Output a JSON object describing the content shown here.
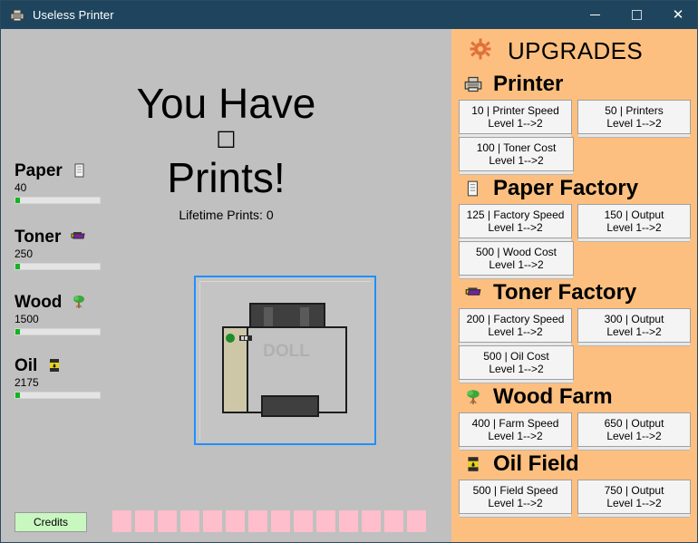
{
  "window": {
    "title": "Useless Printer",
    "icon": "printer-icon",
    "titlebar_color": "#1f455e",
    "controls": {
      "minimize": "—",
      "maximize": "□",
      "close": "✕"
    }
  },
  "resources": [
    {
      "name": "Paper",
      "value": "40",
      "icon": "paper-icon",
      "fill_percent": 5
    },
    {
      "name": "Toner",
      "value": "250",
      "icon": "toner-icon",
      "fill_percent": 5
    },
    {
      "name": "Wood",
      "value": "1500",
      "icon": "wood-icon",
      "fill_percent": 5
    },
    {
      "name": "Oil",
      "value": "2175",
      "icon": "oil-icon",
      "fill_percent": 5
    }
  ],
  "headline": {
    "line1": "You Have",
    "count": "☐",
    "line2": "Prints!",
    "lifetime": "Lifetime Prints: 0"
  },
  "printer": {
    "brand": "DOLL",
    "focus_color": "#1e90ff",
    "led_color": "#1e8c2a"
  },
  "footer": {
    "credits_label": "Credits",
    "credits_color": "#c9f7c0",
    "square_color": "#ffbecb",
    "square_count": 14
  },
  "upgrades": {
    "panel_color": "#fcbf7f",
    "header": {
      "title": "UPGRADES",
      "icon": "gear-icon"
    },
    "sections": [
      {
        "title": "Printer",
        "icon": "printer-icon",
        "buttons": [
          {
            "cost_label": "10 | Printer Speed",
            "level_label": "Level 1-->2"
          },
          {
            "cost_label": "50 | Printers",
            "level_label": "Level 1-->2"
          },
          {
            "cost_label": "100 | Toner Cost",
            "level_label": "Level 1-->2"
          }
        ]
      },
      {
        "title": "Paper Factory",
        "icon": "paper-icon",
        "buttons": [
          {
            "cost_label": "125 | Factory Speed",
            "level_label": "Level 1-->2"
          },
          {
            "cost_label": "150 | Output",
            "level_label": "Level 1-->2"
          },
          {
            "cost_label": "500 | Wood Cost",
            "level_label": "Level 1-->2"
          }
        ]
      },
      {
        "title": "Toner Factory",
        "icon": "toner-icon",
        "buttons": [
          {
            "cost_label": "200 | Factory Speed",
            "level_label": "Level 1-->2"
          },
          {
            "cost_label": "300 | Output",
            "level_label": "Level 1-->2"
          },
          {
            "cost_label": "500 | Oil Cost",
            "level_label": "Level 1-->2"
          }
        ]
      },
      {
        "title": "Wood Farm",
        "icon": "wood-icon",
        "buttons": [
          {
            "cost_label": "400 | Farm Speed",
            "level_label": "Level 1-->2"
          },
          {
            "cost_label": "650 | Output",
            "level_label": "Level 1-->2"
          }
        ]
      },
      {
        "title": "Oil Field",
        "icon": "oil-icon",
        "buttons": [
          {
            "cost_label": "500 | Field Speed",
            "level_label": "Level 1-->2"
          },
          {
            "cost_label": "750 | Output",
            "level_label": "Level 1-->2"
          }
        ]
      }
    ]
  }
}
